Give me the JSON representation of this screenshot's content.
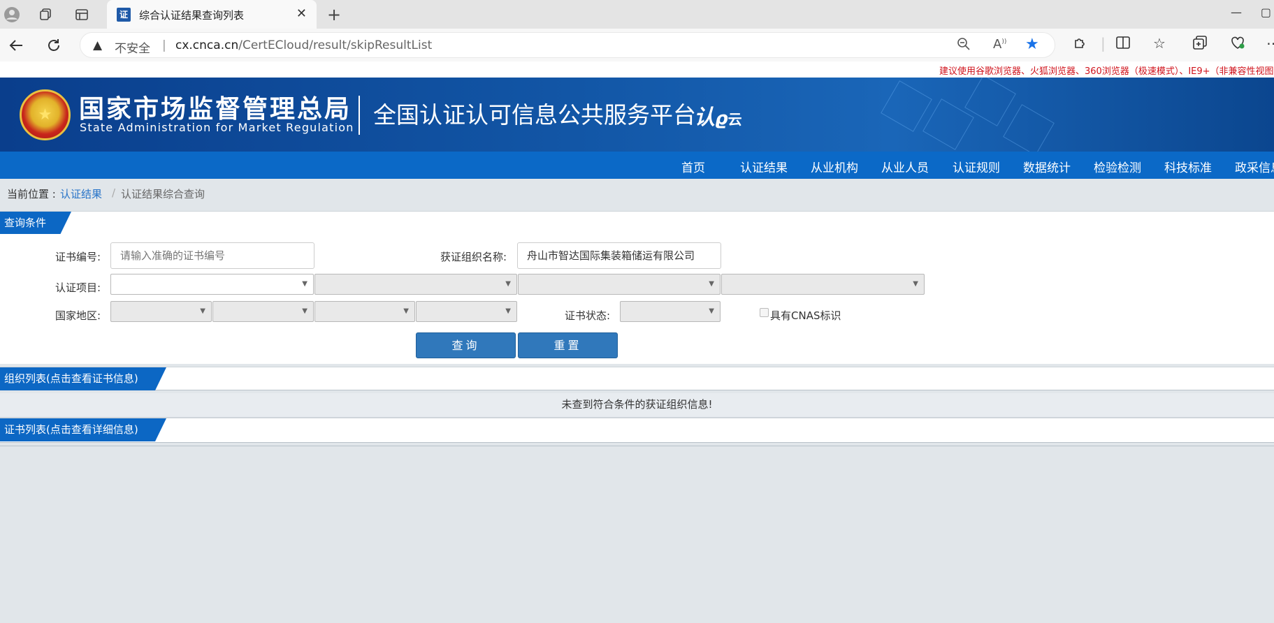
{
  "browser": {
    "tab_title": "综合认证结果查询列表",
    "tab_favicon": "证",
    "security_label": "不安全",
    "url_domain": "cx.cnca.cn",
    "url_path": "/CertECloud/result/skipResultList"
  },
  "notice": "建议使用谷歌浏览器、火狐浏览器、360浏览器（极速模式）、IE9+（非兼容性视图）",
  "header": {
    "org_cn": "国家市场监督管理总局",
    "org_en": "State Administration  for  Market Regulation",
    "platform": "全国认证认可信息公共服务平台",
    "logo_text": "认",
    "logo_sub": "云"
  },
  "nav": [
    "首页",
    "认证结果",
    "从业机构",
    "从业人员",
    "认证规则",
    "数据统计",
    "检验检测",
    "科技标准",
    "政采信息"
  ],
  "breadcrumb": {
    "prefix": "当前位置 :",
    "link": "认证结果",
    "separator": "/",
    "current": "认证结果综合查询"
  },
  "query": {
    "section_title": "查询条件",
    "cert_no_label": "证书编号:",
    "cert_no_placeholder": "请输入准确的证书编号",
    "org_name_label": "获证组织名称:",
    "org_name_value": "舟山市智达国际集装箱储运有限公司",
    "project_label": "认证项目:",
    "region_label": "国家地区:",
    "status_label": "证书状态:",
    "cnas_label": "具有CNAS标识",
    "search_button": "查询",
    "reset_button": "重置"
  },
  "org_list": {
    "section_title": "组织列表(点击查看证书信息)",
    "empty_message": "未查到符合条件的获证组织信息!"
  },
  "cert_list": {
    "section_title": "证书列表(点击查看详细信息)"
  },
  "colors": {
    "banner": "#1256a6",
    "nav": "#0b69c7",
    "button": "#3078bb",
    "notice": "#d0121b",
    "link": "#2874c8"
  }
}
